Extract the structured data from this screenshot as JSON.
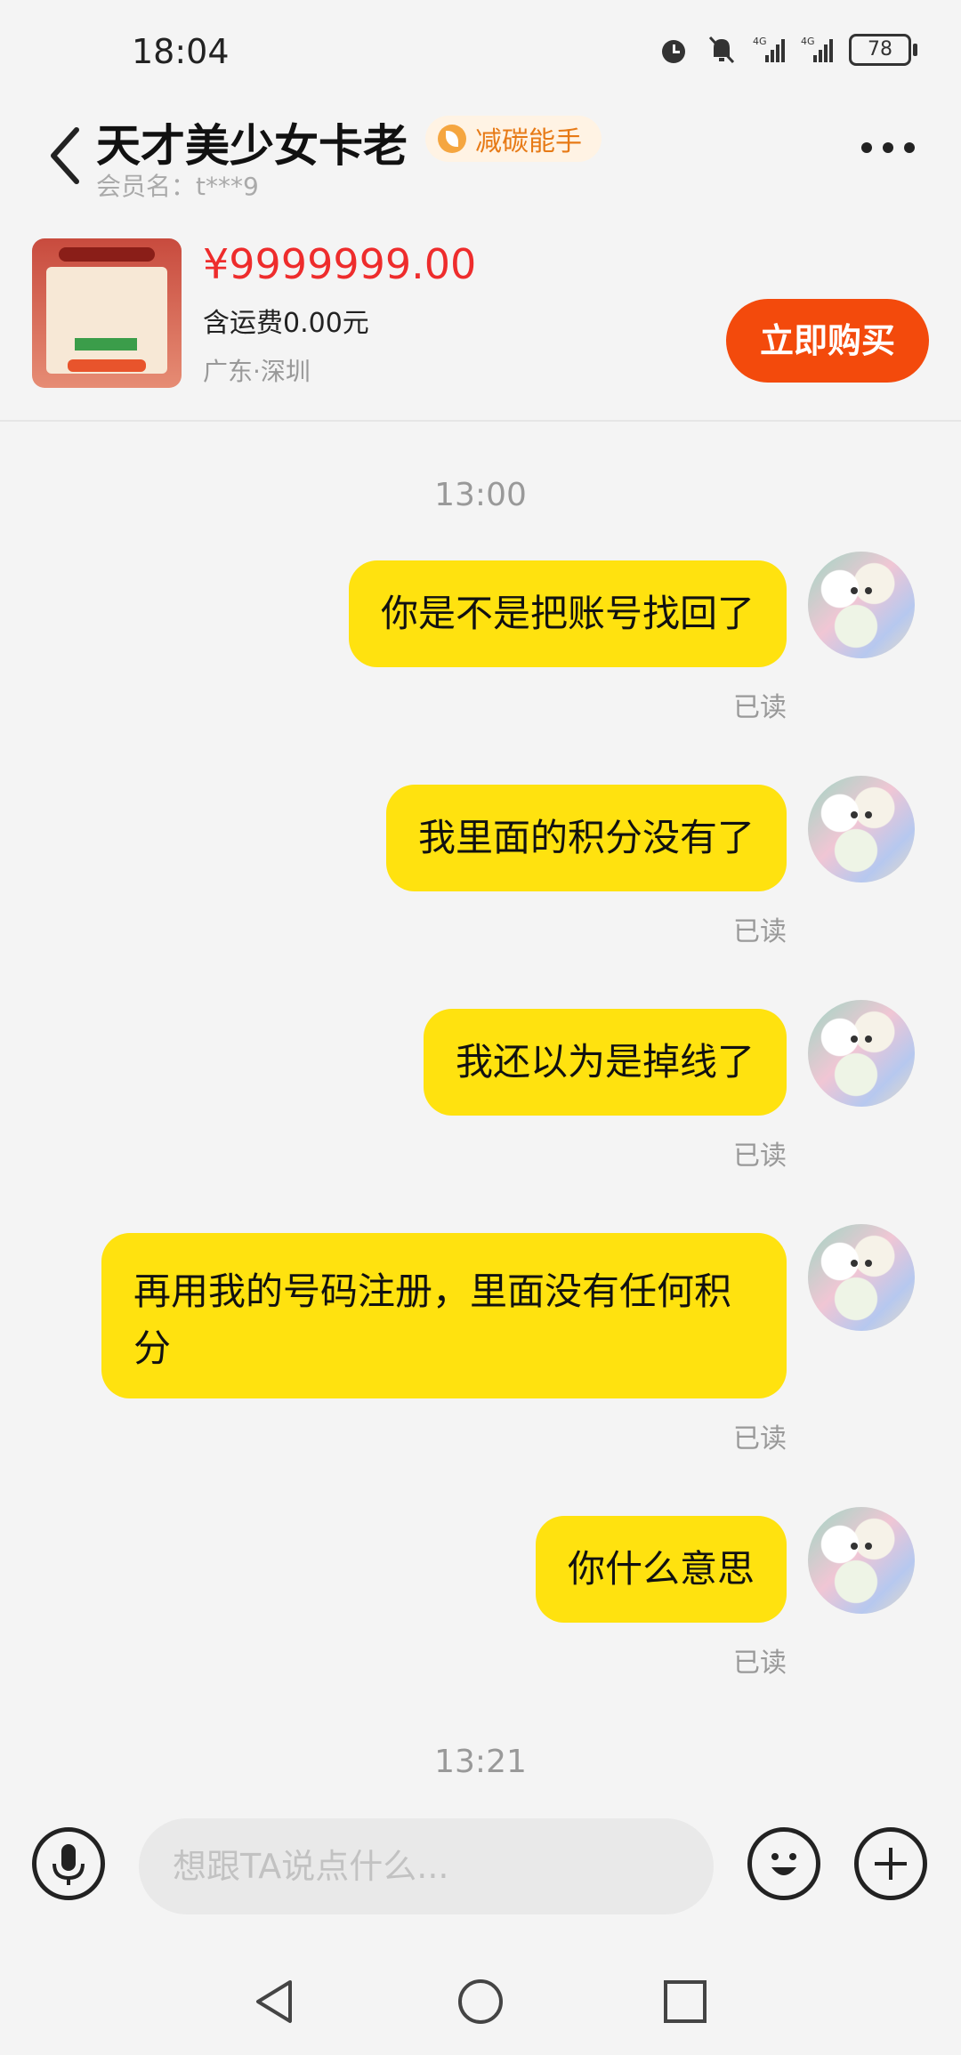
{
  "status_bar": {
    "time": "18:04",
    "battery": "78",
    "net1": "4G",
    "net2": "4G"
  },
  "header": {
    "title": "天才美少女卡老",
    "badge": "减碳能手",
    "subtitle": "会员名：t***9"
  },
  "product": {
    "price": "¥9999999.00",
    "shipping": "含运费0.00元",
    "location": "广东·深圳",
    "buy_label": "立即购买"
  },
  "chat": {
    "timestamps": [
      "13:00",
      "13:21"
    ],
    "messages": [
      {
        "text": "你是不是把账号找回了",
        "status": "已读"
      },
      {
        "text": "我里面的积分没有了",
        "status": "已读"
      },
      {
        "text": "我还以为是掉线了",
        "status": "已读"
      },
      {
        "text": "再用我的号码注册，里面没有任何积分",
        "status": "已读"
      },
      {
        "text": "你什么意思",
        "status": "已读"
      }
    ]
  },
  "input": {
    "placeholder": "想跟TA说点什么..."
  },
  "colors": {
    "bubble": "#ffe20f",
    "price": "#ee2c2c",
    "buy": "#f34a0c"
  },
  "icons": [
    "back-arrow-icon",
    "more-icon",
    "mic-icon",
    "emoji-icon",
    "plus-icon",
    "nav-back-icon",
    "nav-home-icon",
    "nav-recent-icon"
  ]
}
